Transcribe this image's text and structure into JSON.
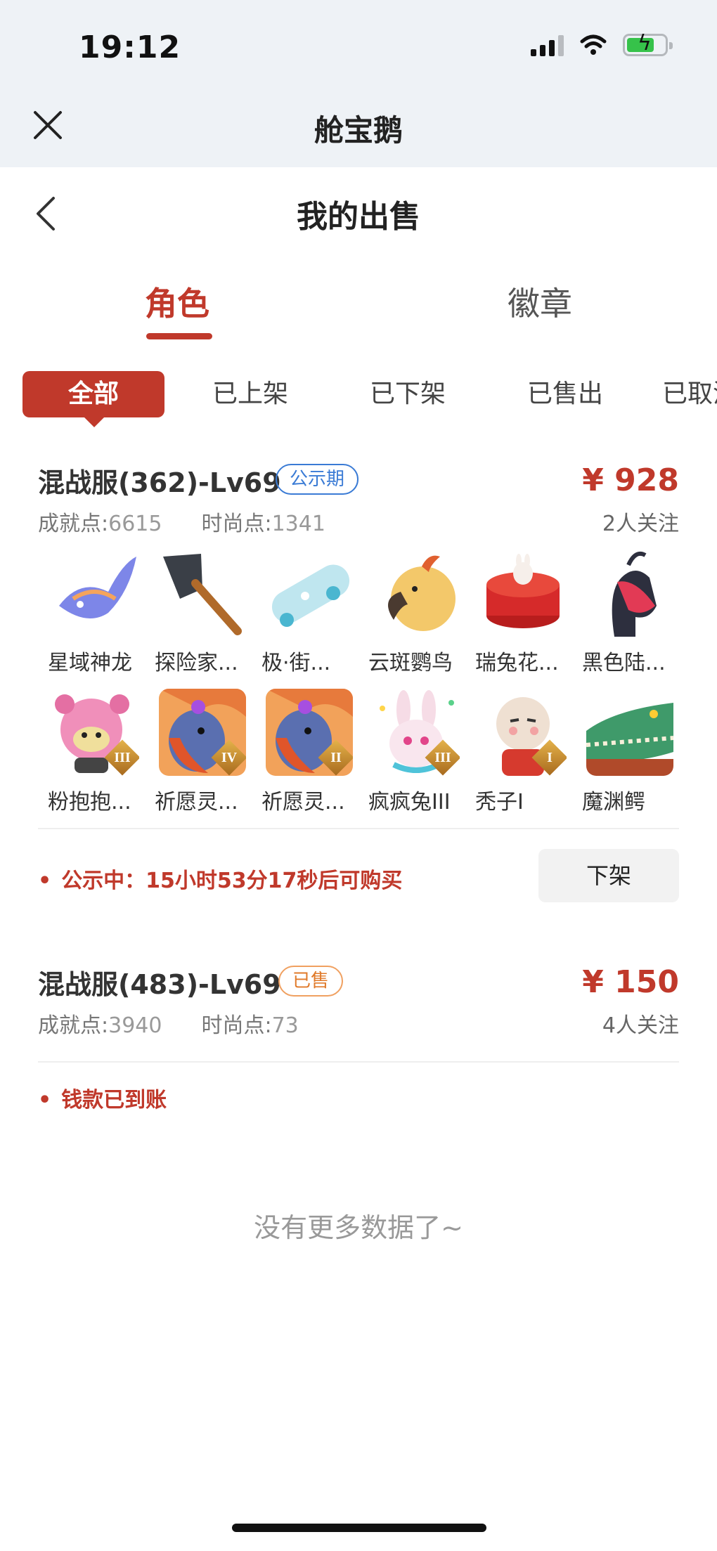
{
  "status_bar": {
    "time": "19:12"
  },
  "app_header": {
    "title": "舱宝鹅"
  },
  "page": {
    "title": "我的出售"
  },
  "tabs": [
    {
      "label": "角色",
      "active": true
    },
    {
      "label": "徽章",
      "active": false
    }
  ],
  "filters": [
    {
      "label": "全部",
      "active": true
    },
    {
      "label": "已上架"
    },
    {
      "label": "已下架"
    },
    {
      "label": "已售出"
    },
    {
      "label": "已取消"
    }
  ],
  "listings": [
    {
      "title": "混战服(362)-Lv69",
      "badge": "公示期",
      "price": "¥ 928",
      "followers": "2人关注",
      "achievement_label": "成就点:",
      "achievement_value": "6615",
      "fashion_label": "时尚点:",
      "fashion_value": "1341",
      "items": [
        {
          "name": "星域神龙",
          "icon": "dragon-icon"
        },
        {
          "name": "探险家...",
          "icon": "shovel-icon"
        },
        {
          "name": "极·街...",
          "icon": "skateboard-icon"
        },
        {
          "name": "云斑鹦鸟",
          "icon": "parrot-icon"
        },
        {
          "name": "瑞兔花...",
          "icon": "cake-icon"
        },
        {
          "name": "黑色陆...",
          "icon": "creature-icon"
        },
        {
          "name": "粉抱抱...",
          "icon": "pink-pet-icon",
          "roman": "III"
        },
        {
          "name": "祈愿灵...",
          "icon": "spirit-bird-icon",
          "roman": "IV"
        },
        {
          "name": "祈愿灵...",
          "icon": "spirit-bird-icon",
          "roman": "II"
        },
        {
          "name": "疯疯兔III",
          "icon": "rabbit-icon",
          "roman": "III"
        },
        {
          "name": "秃子I",
          "icon": "bald-doll-icon",
          "roman": "I"
        },
        {
          "name": "魔渊鳄",
          "icon": "crocodile-icon"
        }
      ],
      "notice": "公示中：15小时53分17秒后可购买",
      "action": "下架"
    },
    {
      "title": "混战服(483)-Lv69",
      "badge": "已售",
      "price": "¥ 150",
      "followers": "4人关注",
      "achievement_label": "成就点:",
      "achievement_value": "3940",
      "fashion_label": "时尚点:",
      "fashion_value": "73",
      "notice": "钱款已到账"
    }
  ],
  "footer": {
    "no_more": "没有更多数据了~"
  },
  "colors": {
    "accent": "#c0392b",
    "badge_blue": "#3a7bd5",
    "badge_orange": "#e07a2a"
  }
}
